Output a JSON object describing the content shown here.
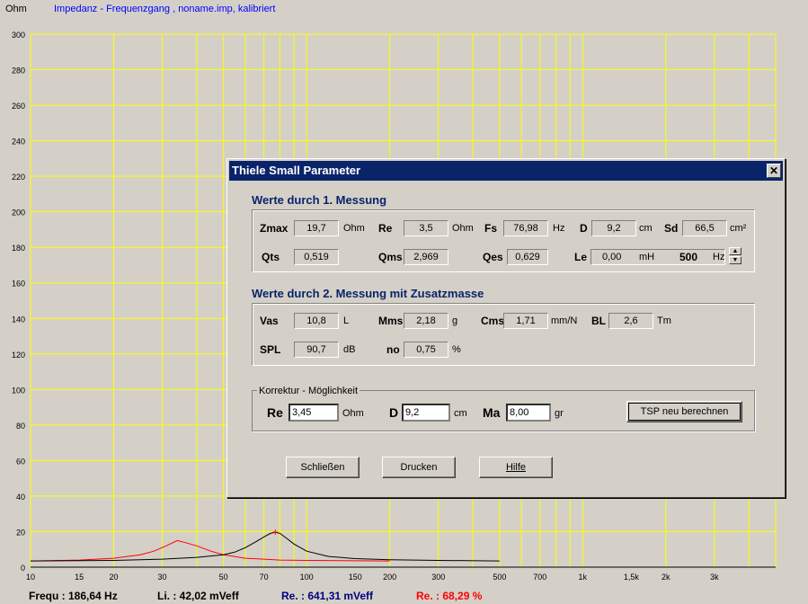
{
  "chart_data": {
    "type": "line",
    "title": "Impedanz - Frequenzgang , noname.imp, kalibriert",
    "ylabel": "Ohm",
    "xlabel": "",
    "x_scale": "log",
    "xlim": [
      10,
      5000
    ],
    "ylim": [
      0,
      300
    ],
    "grid": true,
    "x_tick_labels": [
      {
        "v": 10,
        "t": "10"
      },
      {
        "v": 15,
        "t": "15"
      },
      {
        "v": 20,
        "t": "20"
      },
      {
        "v": 30,
        "t": "30"
      },
      {
        "v": 50,
        "t": "50"
      },
      {
        "v": 70,
        "t": "70"
      },
      {
        "v": 100,
        "t": "100"
      },
      {
        "v": 150,
        "t": "150"
      },
      {
        "v": 200,
        "t": "200"
      },
      {
        "v": 300,
        "t": "300"
      },
      {
        "v": 500,
        "t": "500"
      },
      {
        "v": 700,
        "t": "700"
      },
      {
        "v": 1000,
        "t": "1k"
      },
      {
        "v": 1500,
        "t": "1,5k"
      },
      {
        "v": 2000,
        "t": "2k"
      },
      {
        "v": 3000,
        "t": "3k"
      }
    ],
    "y_ticks": [
      0,
      20,
      40,
      60,
      80,
      100,
      120,
      140,
      160,
      180,
      200,
      220,
      240,
      260,
      280,
      300
    ],
    "series": [
      {
        "color": "#ff0000",
        "x": [
          10,
          15,
          20,
          25,
          28,
          31,
          34,
          36,
          40,
          45,
          50,
          60,
          70,
          80,
          100,
          150,
          200
        ],
        "y": [
          3.5,
          4,
          5,
          7,
          9,
          12,
          15,
          14,
          12,
          9,
          7,
          5,
          4.5,
          4,
          3.8,
          3.6,
          3.5
        ]
      },
      {
        "color": "#000000",
        "x": [
          10,
          20,
          30,
          40,
          50,
          55,
          60,
          65,
          70,
          74,
          77,
          80,
          85,
          90,
          100,
          120,
          150,
          200,
          300,
          500
        ],
        "y": [
          3.5,
          3.8,
          4.5,
          5.5,
          7,
          8.5,
          11,
          14,
          17,
          19,
          19.7,
          19,
          16,
          13,
          9,
          6,
          4.8,
          4.2,
          3.8,
          3.5
        ]
      }
    ],
    "marker": {
      "x": 77,
      "y": 19.7,
      "color": "#ff0000"
    }
  },
  "status": {
    "frequ": "Frequ : 186,64 Hz",
    "li": "Li. : 42,02 mVeff",
    "re_mv": "Re. : 641,31 mVeff",
    "re_pct": "Re. : 68,29 %"
  },
  "colors": {
    "grid": "#ffff00",
    "title_blue": "#0000ff",
    "status_blue": "#000080",
    "status_red": "#ff0000"
  },
  "dialog": {
    "title": "Thiele Small Parameter",
    "close": "✕",
    "section1": "Werte durch 1. Messung",
    "section2": "Werte durch 2. Messung mit Zusatzmasse",
    "m1": {
      "zmax_label": "Zmax",
      "zmax": "19,7",
      "zmax_unit": "Ohm",
      "re_label": "Re",
      "re": "3,5",
      "re_unit": "Ohm",
      "fs_label": "Fs",
      "fs": "76,98",
      "fs_unit": "Hz",
      "d_label": "D",
      "d": "9,2",
      "d_unit": "cm",
      "sd_label": "Sd",
      "sd": "66,5",
      "sd_unit": "cm²",
      "qts_label": "Qts",
      "qts": "0,519",
      "qms_label": "Qms",
      "qms": "2,969",
      "qes_label": "Qes",
      "qes": "0,629",
      "le_label": "Le",
      "le": "0,00",
      "le_unit": "mH",
      "le_freq": "500",
      "le_freq_unit": "Hz"
    },
    "m2": {
      "vas_label": "Vas",
      "vas": "10,8",
      "vas_unit": "L",
      "mms_label": "Mms",
      "mms": "2,18",
      "mms_unit": "g",
      "cms_label": "Cms",
      "cms": "1,71",
      "cms_unit": "mm/N",
      "bl_label": "BL",
      "bl": "2,6",
      "bl_unit": "Tm",
      "spl_label": "SPL",
      "spl": "90,7",
      "spl_unit": "dB",
      "no_label": "no",
      "no": "0,75",
      "no_unit": "%"
    },
    "korrektur": {
      "title": "Korrektur - Möglichkeit",
      "re_label": "Re",
      "re": "3,45",
      "re_unit": "Ohm",
      "d_label": "D",
      "d": "9,2",
      "d_unit": "cm",
      "ma_label": "Ma",
      "ma": "8,00",
      "ma_unit": "gr",
      "recalc": "TSP neu berechnen"
    },
    "buttons": {
      "close": "Schließen",
      "print": "Drucken",
      "help": "Hilfe"
    }
  }
}
